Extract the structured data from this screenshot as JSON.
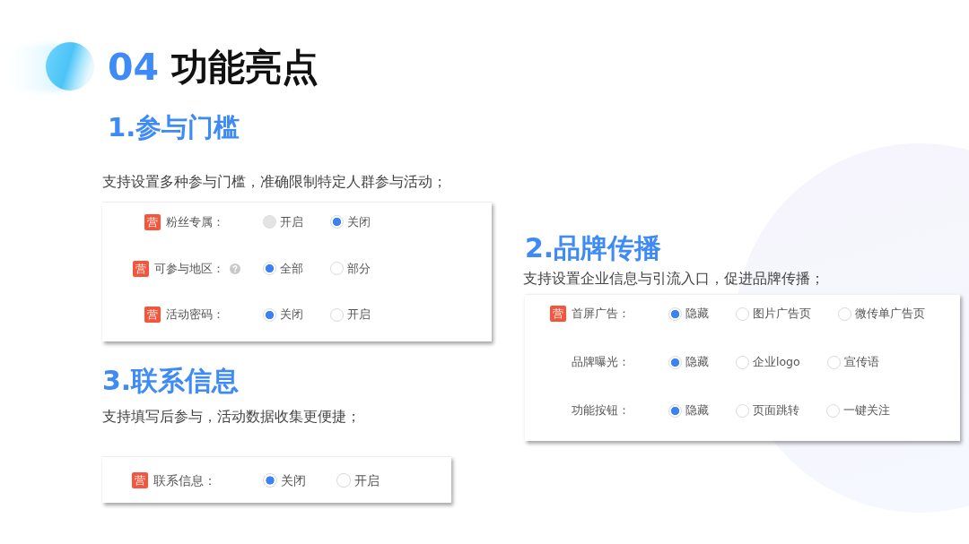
{
  "title": {
    "number": "04",
    "text": "功能亮点"
  },
  "sections": [
    {
      "heading": "1.参与门槛",
      "description": "支持设置多种参与门槛，准确限制特定人群参与活动；",
      "rows": [
        {
          "tag": "营",
          "label": "粉丝专属：",
          "help": false,
          "options": [
            {
              "label": "开启",
              "selected": false,
              "disabled": true
            },
            {
              "label": "关闭",
              "selected": true,
              "disabled": false
            }
          ]
        },
        {
          "tag": "营",
          "label": "可参与地区：",
          "help": true,
          "options": [
            {
              "label": "全部",
              "selected": true,
              "disabled": false
            },
            {
              "label": "部分",
              "selected": false,
              "disabled": false
            }
          ]
        },
        {
          "tag": "营",
          "label": "活动密码：",
          "help": false,
          "options": [
            {
              "label": "关闭",
              "selected": true,
              "disabled": false
            },
            {
              "label": "开启",
              "selected": false,
              "disabled": false
            }
          ]
        }
      ]
    },
    {
      "heading": "2.品牌传播",
      "description": "支持设置企业信息与引流入口，促进品牌传播；",
      "rows": [
        {
          "tag": "营",
          "label": "首屏广告：",
          "help": false,
          "options": [
            {
              "label": "隐藏",
              "selected": true,
              "disabled": false
            },
            {
              "label": "图片广告页",
              "selected": false,
              "disabled": false
            },
            {
              "label": "微传单广告页",
              "selected": false,
              "disabled": false
            }
          ]
        },
        {
          "label": "品牌曝光：",
          "help": false,
          "options": [
            {
              "label": "隐藏",
              "selected": true,
              "disabled": false
            },
            {
              "label": "企业logo",
              "selected": false,
              "disabled": false
            },
            {
              "label": "宣传语",
              "selected": false,
              "disabled": false
            }
          ]
        },
        {
          "label": "功能按钮：",
          "help": false,
          "options": [
            {
              "label": "隐藏",
              "selected": true,
              "disabled": false
            },
            {
              "label": "页面跳转",
              "selected": false,
              "disabled": false
            },
            {
              "label": "一键关注",
              "selected": false,
              "disabled": false
            }
          ]
        }
      ]
    },
    {
      "heading": "3.联系信息",
      "description": "支持填写后参与，活动数据收集更便捷；",
      "rows": [
        {
          "tag": "营",
          "label": "联系信息：",
          "help": false,
          "options": [
            {
              "label": "关闭",
              "selected": true,
              "disabled": false
            },
            {
              "label": "开启",
              "selected": false,
              "disabled": false
            }
          ]
        }
      ]
    }
  ]
}
